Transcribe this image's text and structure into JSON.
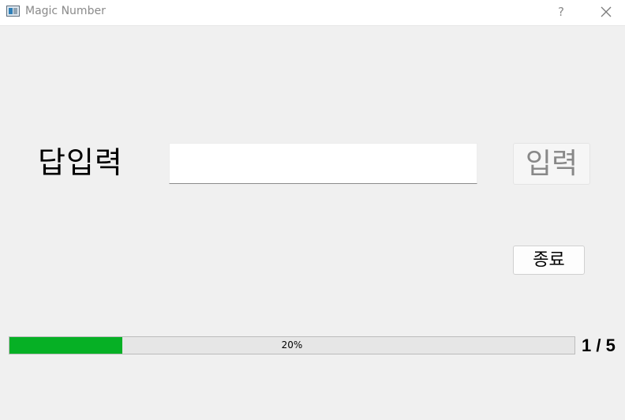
{
  "window": {
    "title": "Magic Number",
    "help_label": "?"
  },
  "form": {
    "answer_label": "답입력",
    "answer_value": "",
    "answer_placeholder": "",
    "submit_label": "입력",
    "quit_label": "종료"
  },
  "progress": {
    "percent": 20,
    "text": "20%",
    "fill_color": "#06b025"
  },
  "counter": {
    "text": "1 / 5"
  }
}
